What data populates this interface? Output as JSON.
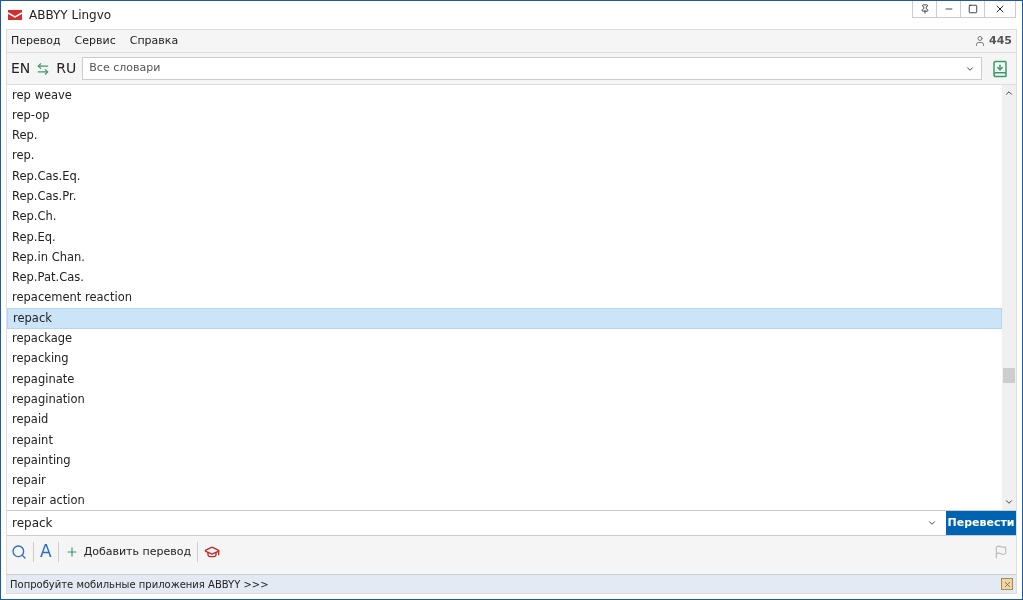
{
  "window": {
    "title": "ABBYY Lingvo"
  },
  "menu": [
    {
      "label": "Перевод"
    },
    {
      "label": "Сервис"
    },
    {
      "label": "Справка"
    }
  ],
  "user_count": "445",
  "languages": {
    "source": "EN",
    "target": "RU"
  },
  "dictionaries": {
    "value": "Все словари"
  },
  "words": [
    {
      "text": "rep weave",
      "selected": false
    },
    {
      "text": "rep-op",
      "selected": false
    },
    {
      "text": "Rep.",
      "selected": false
    },
    {
      "text": "rep.",
      "selected": false
    },
    {
      "text": "Rep.Cas.Eq.",
      "selected": false
    },
    {
      "text": "Rep.Cas.Pr.",
      "selected": false
    },
    {
      "text": "Rep.Ch.",
      "selected": false
    },
    {
      "text": "Rep.Eq.",
      "selected": false
    },
    {
      "text": "Rep.in Chan.",
      "selected": false
    },
    {
      "text": "Rep.Pat.Cas.",
      "selected": false
    },
    {
      "text": "repacement reaction",
      "selected": false
    },
    {
      "text": "repack",
      "selected": true
    },
    {
      "text": "repackage",
      "selected": false
    },
    {
      "text": "repacking",
      "selected": false
    },
    {
      "text": "repaginate",
      "selected": false
    },
    {
      "text": "repagination",
      "selected": false
    },
    {
      "text": "repaid",
      "selected": false
    },
    {
      "text": "repaint",
      "selected": false
    },
    {
      "text": "repainting",
      "selected": false
    },
    {
      "text": "repair",
      "selected": false
    },
    {
      "text": "repair action",
      "selected": false
    }
  ],
  "query": {
    "value": "repack"
  },
  "translate_button": "Перевести",
  "toolbar": {
    "font_button": "A",
    "add_translation": "Добавить перевод"
  },
  "promo": "Попробуйте мобильные приложения ABBYY >>>"
}
